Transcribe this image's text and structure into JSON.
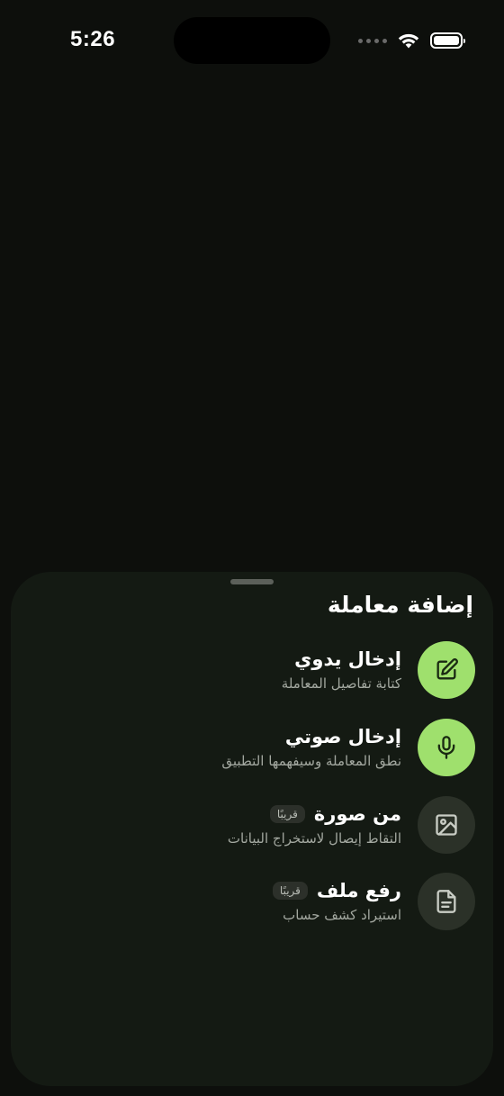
{
  "status_bar": {
    "time": "5:26"
  },
  "sheet": {
    "title": "إضافة معاملة",
    "options": [
      {
        "title": "إدخال يدوي",
        "subtitle": "كتابة تفاصيل المعاملة",
        "icon": "edit-icon",
        "badge": "",
        "active": true
      },
      {
        "title": "إدخال صوتي",
        "subtitle": "نطق المعاملة وسيفهمها التطبيق",
        "icon": "microphone-icon",
        "badge": "",
        "active": true
      },
      {
        "title": "من صورة",
        "subtitle": "التقاط إيصال لاستخراج البيانات",
        "icon": "image-icon",
        "badge": "قريبًا",
        "active": false
      },
      {
        "title": "رفع ملف",
        "subtitle": "استيراد كشف حساب",
        "icon": "file-icon",
        "badge": "قريبًا",
        "active": false
      }
    ]
  },
  "colors": {
    "accent": "#9fe06d",
    "sheet_background": "#141a13",
    "muted_icon_background": "#2b3128"
  }
}
